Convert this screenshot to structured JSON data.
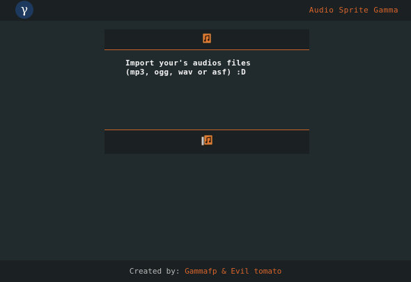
{
  "header": {
    "logo_glyph": "γ",
    "app_title": "Audio Sprite Gamma"
  },
  "panel_top": {
    "icon": "audio-file-icon"
  },
  "drop_area": {
    "line1": "Import your's audios files",
    "line2": "(mp3, ogg, wav or asf) :D"
  },
  "panel_bottom": {
    "icon": "audio-sprite-icon"
  },
  "footer": {
    "prefix": "Created by: ",
    "author1": "Gammafp",
    "separator": " & ",
    "author2": "Evil tomato"
  },
  "colors": {
    "accent": "#d9652b",
    "background": "#212a2d",
    "bar": "#1b2023",
    "logo_bg": "#1d3a5e"
  }
}
